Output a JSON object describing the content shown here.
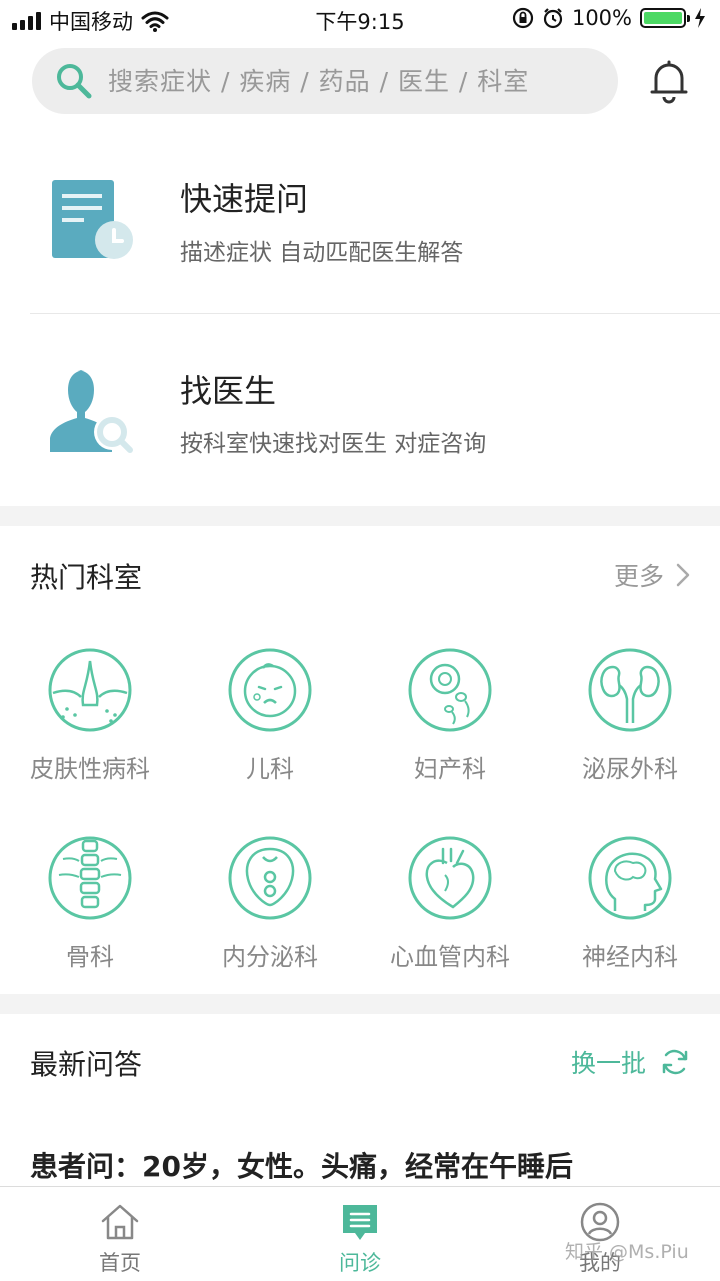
{
  "status_bar": {
    "carrier": "中国移动",
    "time": "下午9:15",
    "battery": "100%"
  },
  "search": {
    "placeholder": "搜索症状 / 疾病 / 药品 / 医生 / 科室",
    "icon": "search-icon"
  },
  "features": [
    {
      "title": "快速提问",
      "desc": "描述症状 自动匹配医生解答",
      "icon": "document-clock-icon"
    },
    {
      "title": "找医生",
      "desc": "按科室快速找对医生 对症咨询",
      "icon": "doctor-search-icon"
    }
  ],
  "departments_section": {
    "title": "热门科室",
    "more_label": "更多",
    "items": [
      {
        "label": "皮肤性病科",
        "icon": "skin-icon"
      },
      {
        "label": "儿科",
        "icon": "baby-icon"
      },
      {
        "label": "妇产科",
        "icon": "egg-sperm-icon"
      },
      {
        "label": "泌尿外科",
        "icon": "kidney-icon"
      },
      {
        "label": "骨科",
        "icon": "spine-icon"
      },
      {
        "label": "内分泌科",
        "icon": "endocrine-icon"
      },
      {
        "label": "心血管内科",
        "icon": "heart-icon"
      },
      {
        "label": "神经内科",
        "icon": "brain-icon"
      }
    ]
  },
  "qa_section": {
    "title": "最新问答",
    "refresh_label": "换一批",
    "question": "患者问：20岁，女性。头痛，经常在午睡后"
  },
  "tab_bar": [
    {
      "label": "首页",
      "icon": "home-icon",
      "active": false
    },
    {
      "label": "问诊",
      "icon": "consult-icon",
      "active": true
    },
    {
      "label": "我的",
      "icon": "profile-icon",
      "active": false
    }
  ],
  "watermark": "知乎 @Ms.Piu",
  "colors": {
    "accent": "#4db89a",
    "icon_blue": "#5aabbf",
    "search_bg": "#ededed"
  }
}
